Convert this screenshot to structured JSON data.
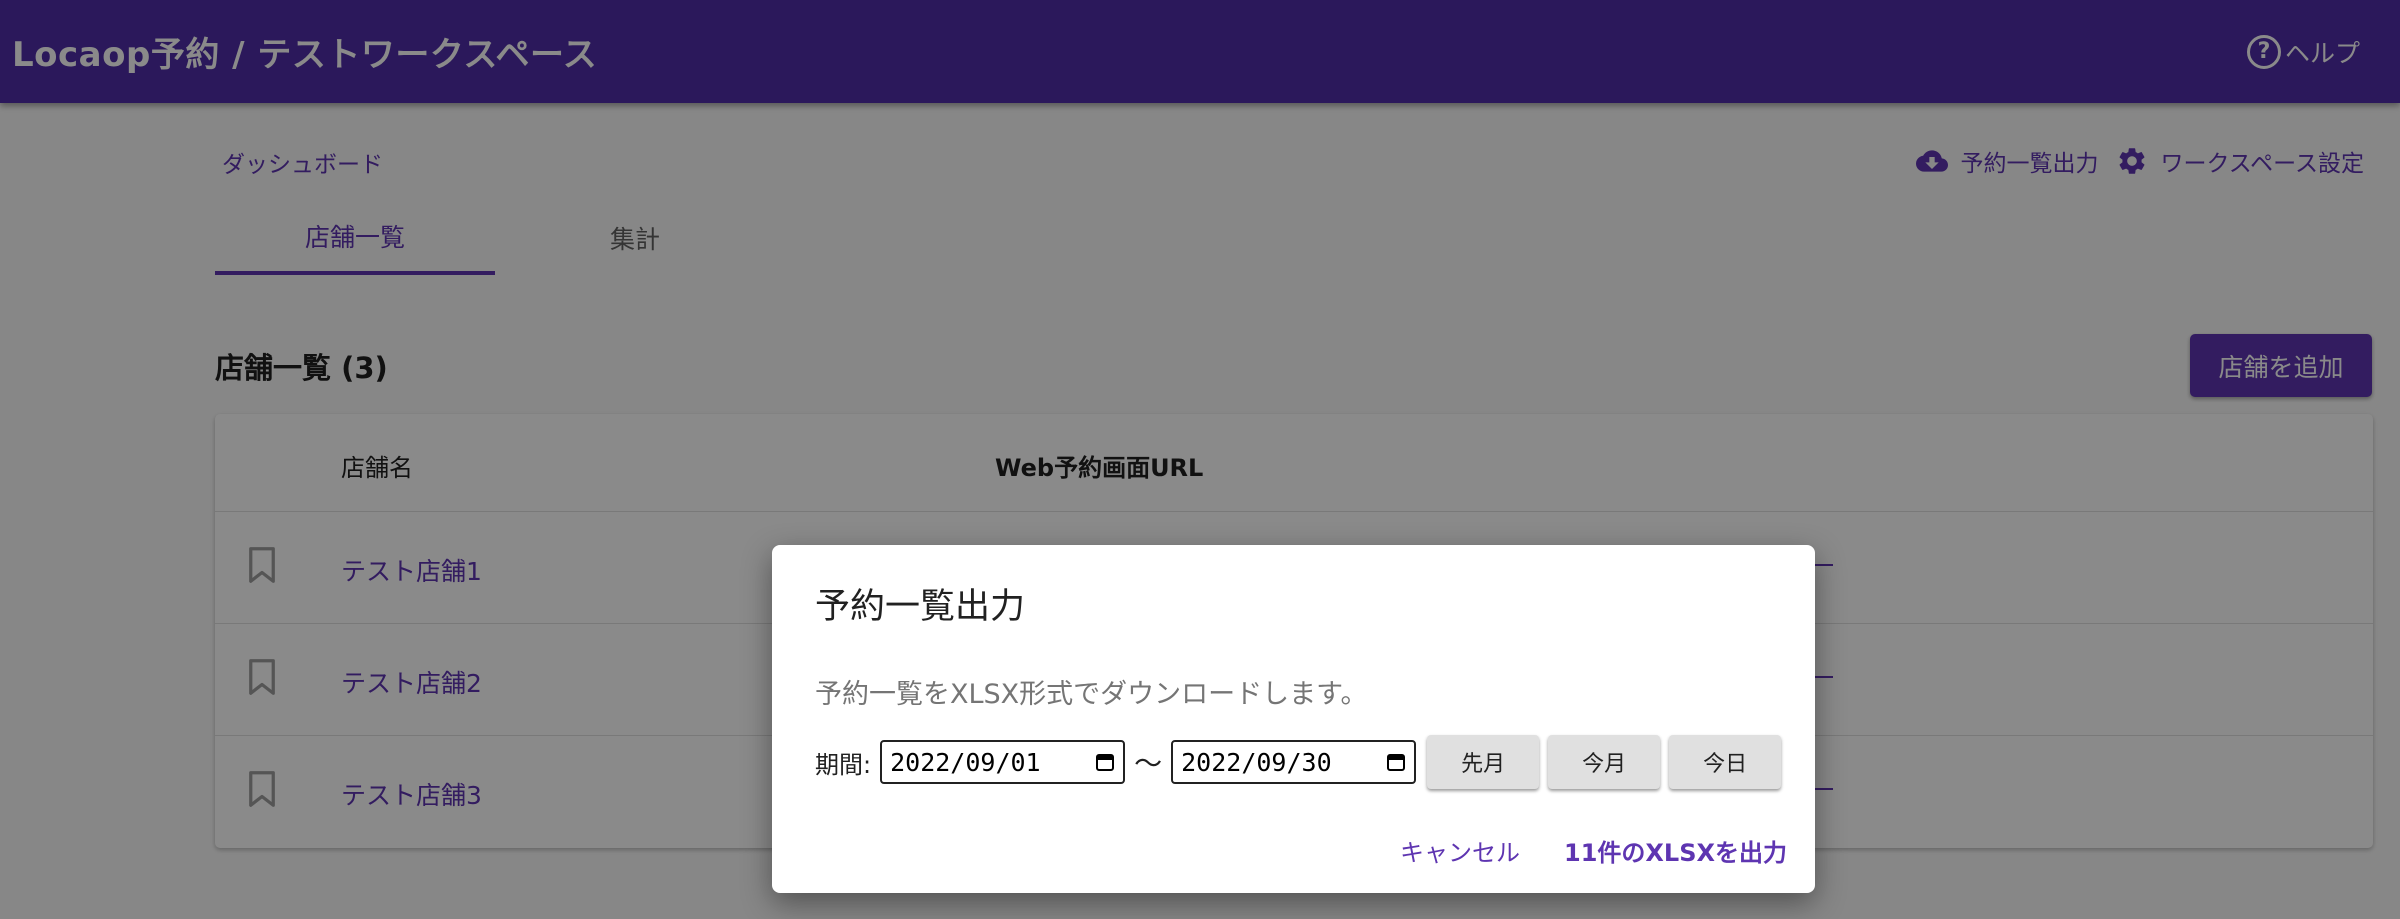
{
  "app": {
    "title": "Locaop予約 / テストワークスペース",
    "help_label": "ヘルプ",
    "help_glyph": "?"
  },
  "breadcrumb": "ダッシュボード",
  "top_actions": {
    "export_label": "予約一覧出力",
    "settings_label": "ワークスペース設定"
  },
  "tabs": [
    {
      "label": "店舗一覧",
      "active": true
    },
    {
      "label": "集計",
      "active": false
    }
  ],
  "section": {
    "title": "店舗一覧 (3)",
    "add_button": "店舗を追加"
  },
  "table": {
    "columns": [
      "店舗名",
      "Web予約画面URL"
    ],
    "rows": [
      {
        "name": "テスト店舗1"
      },
      {
        "name": "テスト店舗2"
      },
      {
        "name": "テスト店舗3"
      }
    ]
  },
  "dialog": {
    "title": "予約一覧出力",
    "description": "予約一覧をXLSX形式でダウンロードします。",
    "period_label": "期間:",
    "start_date": "2022/09/01",
    "separator": "〜",
    "end_date": "2022/09/30",
    "quick_buttons": [
      "先月",
      "今月",
      "今日"
    ],
    "cancel_label": "キャンセル",
    "export_label": "11件のXLSXを出力"
  },
  "colors": {
    "appbar": "#512da8",
    "accent": "#5e35b1"
  }
}
